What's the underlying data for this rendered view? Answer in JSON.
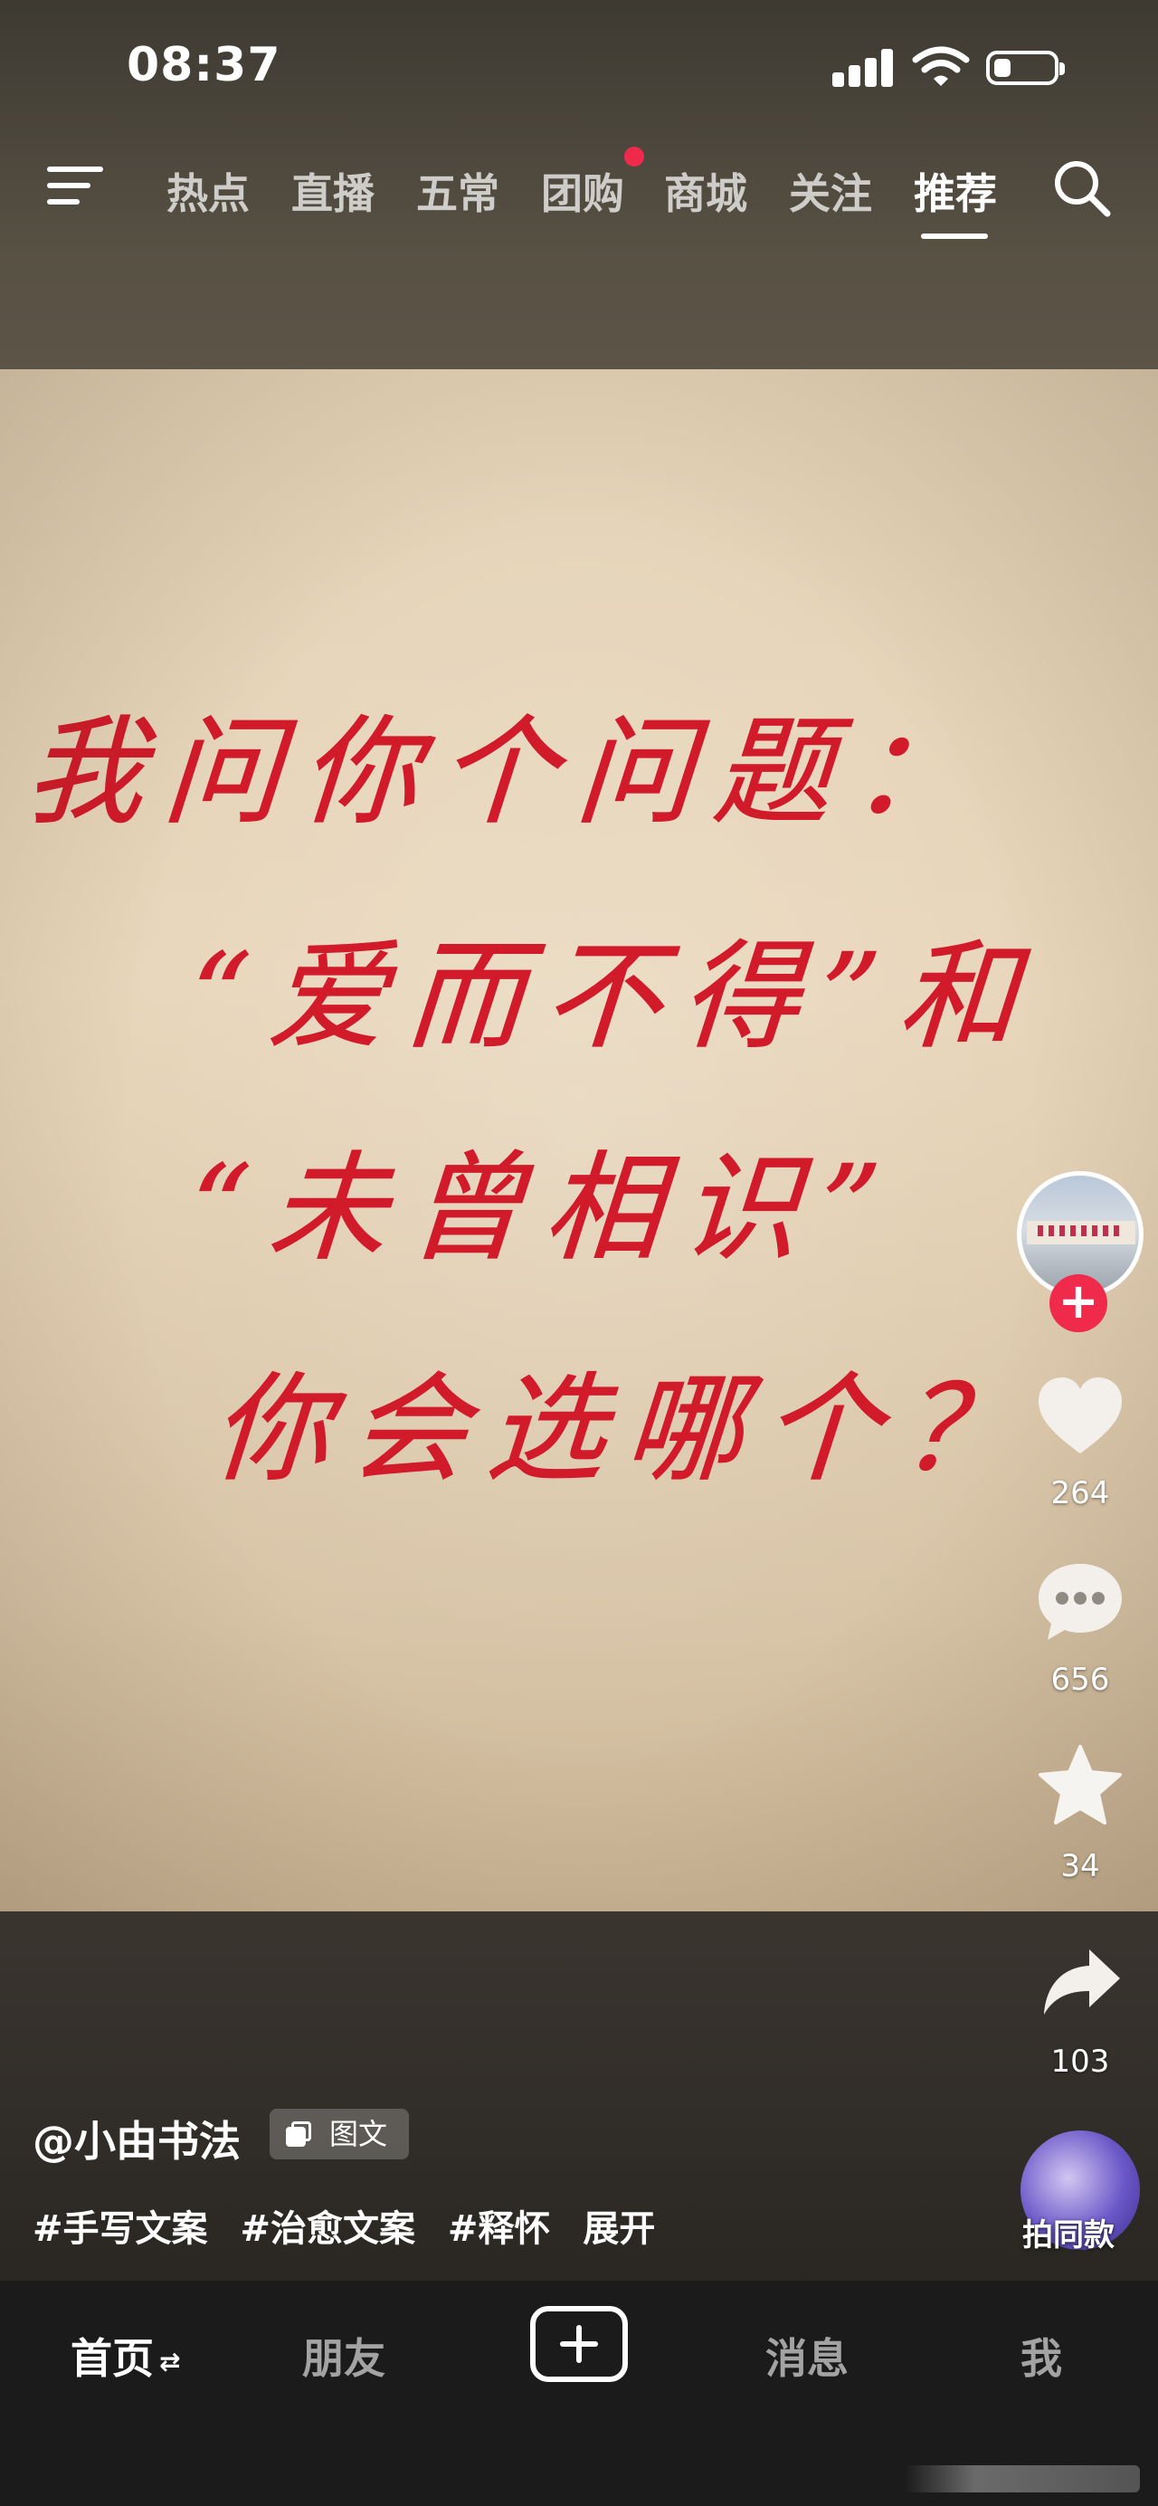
{
  "status_bar": {
    "time": "08:37"
  },
  "top_nav": {
    "tabs": [
      {
        "label": "热点"
      },
      {
        "label": "直播"
      },
      {
        "label": "五常"
      },
      {
        "label": "团购",
        "notification_dot": true
      },
      {
        "label": "商城"
      },
      {
        "label": "关注"
      },
      {
        "label": "推荐",
        "active": true
      }
    ],
    "icons": [
      "menu-icon",
      "search-icon"
    ]
  },
  "post_image": {
    "lines": [
      "我问你个问题：",
      "“爱而不得”和",
      "“未曾相识”",
      "你会选哪个？"
    ],
    "ink_color": "#d11a2a"
  },
  "right_rail": {
    "likes": "264",
    "comments": "656",
    "favorites": "34",
    "shares": "103",
    "same_style_label": "拍同款",
    "follow_symbol": "+"
  },
  "caption": {
    "author": "@小由书法",
    "badge": "图文",
    "hashtags": [
      "#手写文案",
      "#治愈文案",
      "#释怀"
    ],
    "expand": "展开"
  },
  "tab_bar": {
    "items": [
      {
        "label": "首页",
        "active": true
      },
      {
        "label": "朋友"
      },
      {
        "label": "消息"
      },
      {
        "label": "我"
      }
    ]
  },
  "colors": {
    "accent": "#f02a4b",
    "ink": "#d11a2a",
    "tabbar": "#1b1b1b"
  }
}
